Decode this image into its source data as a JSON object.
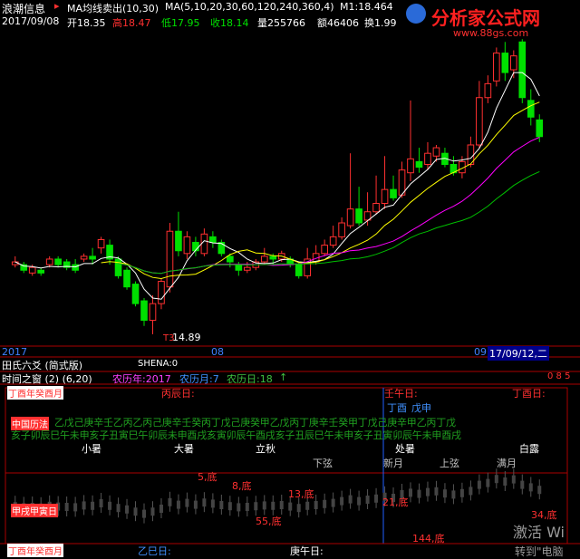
{
  "app": {
    "name": "浪潮信息",
    "indicator": "MA均线卖出(10,30)",
    "ma_params": "MA(5,10,20,30,60,120,240,360,4)",
    "m1": "M1:18.464"
  },
  "info": {
    "date": "2017/09/08",
    "open": "开18.35",
    "high": "高18.47",
    "low": "低17.95",
    "close": "收18.14",
    "vol": "量255766",
    "amount": "额46406",
    "turnover": "换1.99"
  },
  "watermark": {
    "title": "分析家公式网",
    "url": "www.88gs.com",
    "corner1": "激活 Wi",
    "corner2": "转到\"电脑"
  },
  "price_labels": {
    "low": "14.89",
    "arrow": "T3"
  },
  "dates": {
    "d1": "2017",
    "d2": "08",
    "d3": "09",
    "current": "17/09/12,二"
  },
  "panel1": {
    "title": "田氏六爻  (简式版)",
    "shena": "SHENA:0"
  },
  "panel2": {
    "title": "时间之窗 (2) (6,20)",
    "lunar_year": "农历年:2017",
    "lunar_month": "农历月:7",
    "lunar_day": "农历日:18",
    "arrow": "↑",
    "right_nums": "0  8  5",
    "label_tl": "丁酉年癸酉月",
    "bing_chen": "丙辰日:",
    "ren_wu": "壬午日:",
    "ding_you": "丁酉日:",
    "ding_you2": "丁酉",
    "wu_shen": "戊申",
    "left_label": "中国历法",
    "ganzhi_row1": "乙戊己庚辛壬乙丙乙丙己庚辛壬癸丙丁戊己庚癸甲乙戊丙丁庚辛壬癸甲丁戊己庚辛甲乙丙丁戊",
    "ganzhi_row2": "亥子卯辰巳午未申亥子丑寅巳午卯辰未申酉戌亥寅卯辰午酉戌亥子丑辰巳午未申亥子丑寅卯辰午未申酉戌",
    "solar_terms": [
      "小暑",
      "大暑",
      "立秋",
      "处暑",
      "白露"
    ],
    "moon": [
      "下弦",
      "新月",
      "上弦",
      "满月"
    ],
    "bottom_labels": [
      "5,底",
      "8,底",
      "13,底",
      "55,底",
      "21,底",
      "34,底",
      "144,底"
    ],
    "left_lower": "甲戌甲寅日",
    "label_bl": "丁酉年癸酉月",
    "yi_si": "乙巳日:",
    "geng_wu": "庚午日:"
  },
  "chart_data": {
    "type": "candlestick",
    "title": "",
    "ma_series": [
      "MA5",
      "MA10",
      "MA20",
      "MA30",
      "MA60"
    ],
    "colors": {
      "up": "#ff3030",
      "down": "#00e000",
      "ma5": "#ffffff",
      "ma10": "#ffff00",
      "ma20": "#ff00ff",
      "ma30": "#00c000"
    },
    "candles": [
      {
        "o": 13.6,
        "c": 13.7,
        "h": 13.9,
        "l": 13.5
      },
      {
        "o": 13.6,
        "c": 13.4,
        "h": 13.7,
        "l": 13.3
      },
      {
        "o": 13.3,
        "c": 13.5,
        "h": 13.6,
        "l": 13.2
      },
      {
        "o": 13.4,
        "c": 13.3,
        "h": 13.5,
        "l": 13.2
      },
      {
        "o": 13.6,
        "c": 13.8,
        "h": 13.9,
        "l": 13.5
      },
      {
        "o": 13.8,
        "c": 13.6,
        "h": 13.9,
        "l": 13.5
      },
      {
        "o": 13.7,
        "c": 13.5,
        "h": 13.8,
        "l": 13.4
      },
      {
        "o": 13.6,
        "c": 13.4,
        "h": 13.8,
        "l": 13.3
      },
      {
        "o": 13.8,
        "c": 13.9,
        "h": 14.0,
        "l": 13.7
      },
      {
        "o": 13.9,
        "c": 13.8,
        "h": 14.2,
        "l": 13.6
      },
      {
        "o": 14.2,
        "c": 14.5,
        "h": 14.6,
        "l": 14.0
      },
      {
        "o": 14.3,
        "c": 13.8,
        "h": 14.5,
        "l": 13.6
      },
      {
        "o": 13.8,
        "c": 13.2,
        "h": 13.9,
        "l": 13.1
      },
      {
        "o": 13.4,
        "c": 12.8,
        "h": 13.5,
        "l": 12.7
      },
      {
        "o": 12.9,
        "c": 12.2,
        "h": 13.0,
        "l": 12.1
      },
      {
        "o": 12.3,
        "c": 11.6,
        "h": 12.4,
        "l": 11.4
      },
      {
        "o": 11.6,
        "c": 12.2,
        "h": 12.5,
        "l": 11.1
      },
      {
        "o": 12.2,
        "c": 13.0,
        "h": 13.1,
        "l": 12.0
      },
      {
        "o": 12.8,
        "c": 14.8,
        "h": 15.1,
        "l": 12.6
      },
      {
        "o": 14.8,
        "c": 14.1,
        "h": 15.5,
        "l": 13.9
      },
      {
        "o": 14.0,
        "c": 14.6,
        "h": 14.8,
        "l": 13.8
      },
      {
        "o": 14.4,
        "c": 14.1,
        "h": 14.6,
        "l": 13.9
      },
      {
        "o": 14.0,
        "c": 14.7,
        "h": 14.9,
        "l": 13.9
      },
      {
        "o": 14.6,
        "c": 14.4,
        "h": 14.8,
        "l": 14.2
      },
      {
        "o": 14.4,
        "c": 14.0,
        "h": 14.5,
        "l": 13.9
      },
      {
        "o": 13.9,
        "c": 13.7,
        "h": 14.0,
        "l": 13.5
      },
      {
        "o": 13.6,
        "c": 13.4,
        "h": 13.7,
        "l": 13.2
      },
      {
        "o": 13.4,
        "c": 13.5,
        "h": 13.7,
        "l": 13.3
      },
      {
        "o": 13.5,
        "c": 13.7,
        "h": 13.8,
        "l": 13.4
      },
      {
        "o": 13.7,
        "c": 13.9,
        "h": 14.2,
        "l": 13.6
      },
      {
        "o": 13.9,
        "c": 13.8,
        "h": 14.0,
        "l": 13.6
      },
      {
        "o": 13.8,
        "c": 14.0,
        "h": 14.1,
        "l": 13.7
      },
      {
        "o": 13.8,
        "c": 13.6,
        "h": 13.9,
        "l": 13.5
      },
      {
        "o": 13.6,
        "c": 13.2,
        "h": 13.7,
        "l": 13.1
      },
      {
        "o": 13.2,
        "c": 13.8,
        "h": 14.2,
        "l": 13.1
      },
      {
        "o": 13.7,
        "c": 14.0,
        "h": 14.3,
        "l": 13.6
      },
      {
        "o": 14.0,
        "c": 14.3,
        "h": 14.5,
        "l": 13.9
      },
      {
        "o": 14.3,
        "c": 14.6,
        "h": 15.0,
        "l": 14.2
      },
      {
        "o": 14.6,
        "c": 15.1,
        "h": 15.3,
        "l": 14.5
      },
      {
        "o": 15.0,
        "c": 15.6,
        "h": 17.6,
        "l": 14.9
      },
      {
        "o": 15.6,
        "c": 15.1,
        "h": 16.4,
        "l": 15.0
      },
      {
        "o": 15.2,
        "c": 15.5,
        "h": 16.2,
        "l": 15.0
      },
      {
        "o": 15.5,
        "c": 15.8,
        "h": 16.8,
        "l": 15.4
      },
      {
        "o": 15.8,
        "c": 16.3,
        "h": 17.5,
        "l": 15.6
      },
      {
        "o": 16.3,
        "c": 16.0,
        "h": 16.8,
        "l": 15.9
      },
      {
        "o": 16.1,
        "c": 17.0,
        "h": 17.3,
        "l": 16.0
      },
      {
        "o": 16.9,
        "c": 17.4,
        "h": 19.5,
        "l": 16.6
      },
      {
        "o": 17.3,
        "c": 17.1,
        "h": 17.8,
        "l": 16.9
      },
      {
        "o": 17.2,
        "c": 17.6,
        "h": 18.0,
        "l": 17.0
      },
      {
        "o": 17.5,
        "c": 17.8,
        "h": 17.9,
        "l": 17.3
      },
      {
        "o": 17.6,
        "c": 17.2,
        "h": 17.8,
        "l": 17.1
      },
      {
        "o": 17.2,
        "c": 16.9,
        "h": 17.5,
        "l": 16.8
      },
      {
        "o": 16.9,
        "c": 17.3,
        "h": 17.5,
        "l": 16.7
      },
      {
        "o": 17.2,
        "c": 17.9,
        "h": 18.2,
        "l": 17.1
      },
      {
        "o": 17.9,
        "c": 19.6,
        "h": 20.2,
        "l": 17.8
      },
      {
        "o": 19.6,
        "c": 20.1,
        "h": 20.4,
        "l": 19.4
      },
      {
        "o": 20.2,
        "c": 21.2,
        "h": 21.4,
        "l": 20.0
      },
      {
        "o": 21.2,
        "c": 20.5,
        "h": 21.6,
        "l": 20.2
      },
      {
        "o": 20.6,
        "c": 21.1,
        "h": 21.3,
        "l": 20.3
      },
      {
        "o": 21.6,
        "c": 19.6,
        "h": 21.7,
        "l": 19.4
      },
      {
        "o": 19.5,
        "c": 18.9,
        "h": 19.9,
        "l": 18.6
      },
      {
        "o": 18.8,
        "c": 18.2,
        "h": 19.0,
        "l": 18.0
      }
    ],
    "ylim": [
      11,
      22
    ]
  }
}
